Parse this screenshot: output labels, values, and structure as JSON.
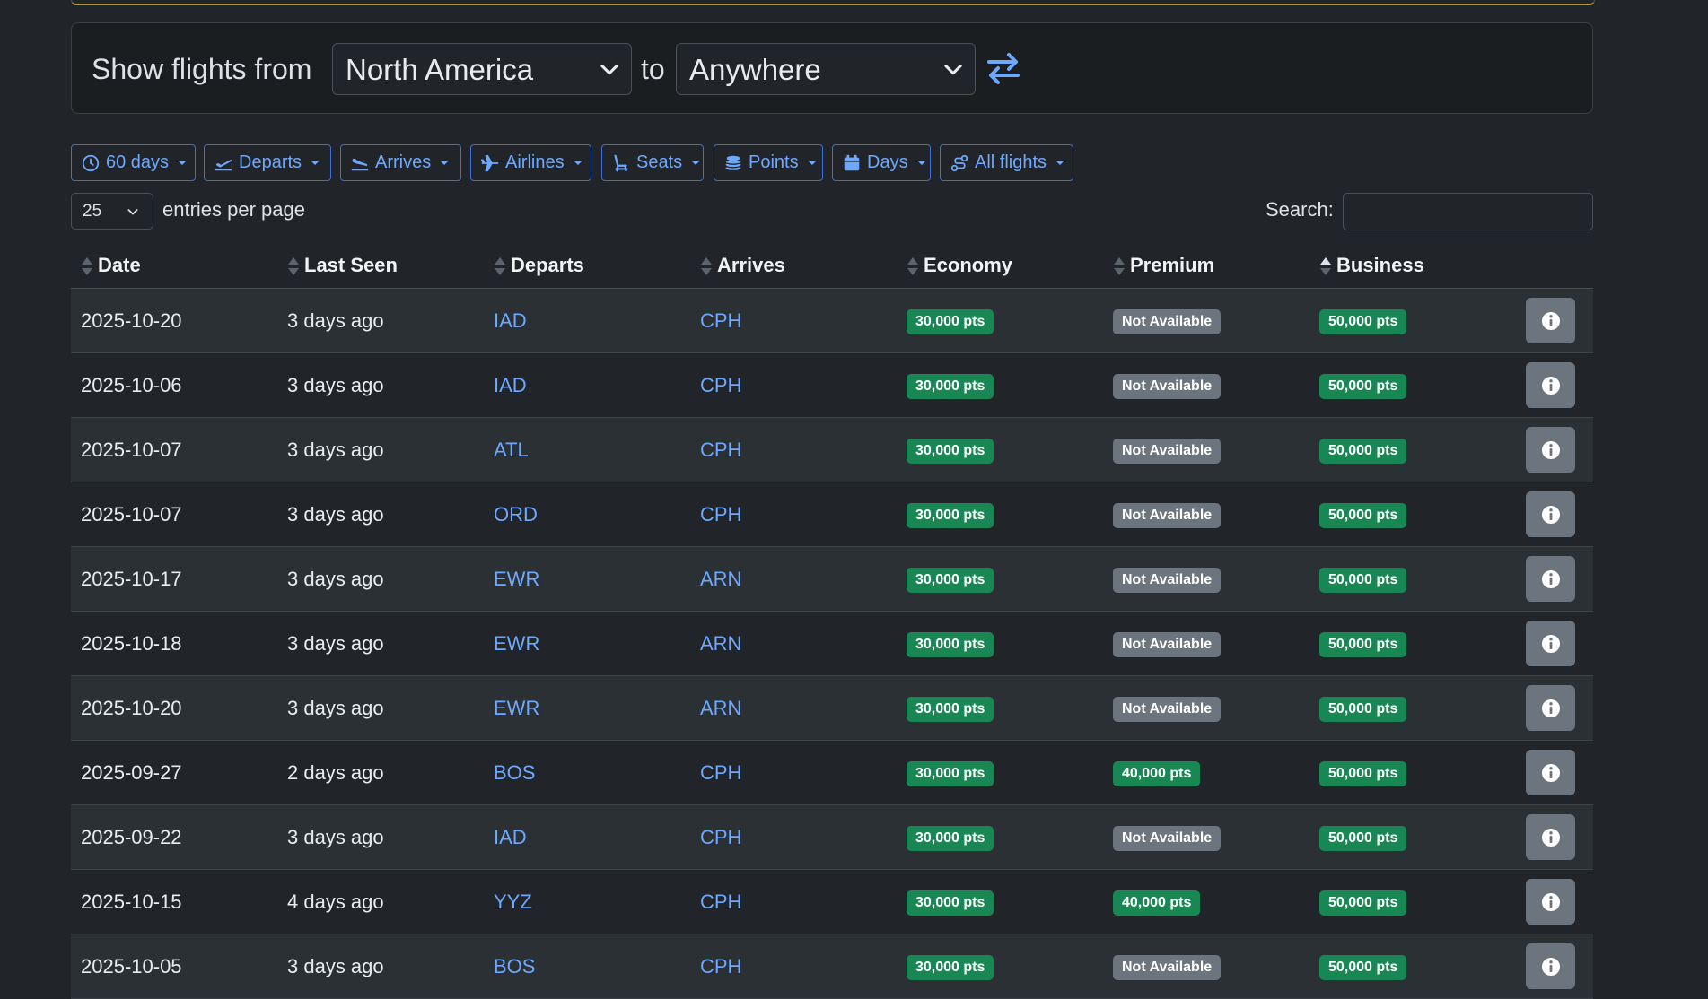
{
  "route": {
    "from_label": "Show flights from",
    "from_value": "North America",
    "to_label": "to",
    "to_value": "Anywhere"
  },
  "filters": [
    {
      "label": "60 days",
      "icon": "clock-icon"
    },
    {
      "label": "Departs",
      "icon": "plane-departure-icon"
    },
    {
      "label": "Arrives",
      "icon": "plane-arrival-icon"
    },
    {
      "label": "Airlines",
      "icon": "plane-icon"
    },
    {
      "label": "Seats",
      "icon": "seat-icon"
    },
    {
      "label": "Points",
      "icon": "coins-icon"
    },
    {
      "label": "Days",
      "icon": "calendar-icon"
    },
    {
      "label": "All flights",
      "icon": "route-icon"
    }
  ],
  "table_controls": {
    "page_length": "25",
    "page_length_label": "entries per page",
    "search_label": "Search:",
    "search_value": ""
  },
  "columns": [
    "Date",
    "Last Seen",
    "Departs",
    "Arrives",
    "Economy",
    "Premium",
    "Business"
  ],
  "sorted_column": "Business",
  "rows": [
    {
      "date": "2025-10-20",
      "last_seen": "3 days ago",
      "departs": "IAD",
      "arrives": "CPH",
      "economy": "30,000 pts",
      "premium": "Not Available",
      "business": "50,000 pts"
    },
    {
      "date": "2025-10-06",
      "last_seen": "3 days ago",
      "departs": "IAD",
      "arrives": "CPH",
      "economy": "30,000 pts",
      "premium": "Not Available",
      "business": "50,000 pts"
    },
    {
      "date": "2025-10-07",
      "last_seen": "3 days ago",
      "departs": "ATL",
      "arrives": "CPH",
      "economy": "30,000 pts",
      "premium": "Not Available",
      "business": "50,000 pts"
    },
    {
      "date": "2025-10-07",
      "last_seen": "3 days ago",
      "departs": "ORD",
      "arrives": "CPH",
      "economy": "30,000 pts",
      "premium": "Not Available",
      "business": "50,000 pts"
    },
    {
      "date": "2025-10-17",
      "last_seen": "3 days ago",
      "departs": "EWR",
      "arrives": "ARN",
      "economy": "30,000 pts",
      "premium": "Not Available",
      "business": "50,000 pts"
    },
    {
      "date": "2025-10-18",
      "last_seen": "3 days ago",
      "departs": "EWR",
      "arrives": "ARN",
      "economy": "30,000 pts",
      "premium": "Not Available",
      "business": "50,000 pts"
    },
    {
      "date": "2025-10-20",
      "last_seen": "3 days ago",
      "departs": "EWR",
      "arrives": "ARN",
      "economy": "30,000 pts",
      "premium": "Not Available",
      "business": "50,000 pts"
    },
    {
      "date": "2025-09-27",
      "last_seen": "2 days ago",
      "departs": "BOS",
      "arrives": "CPH",
      "economy": "30,000 pts",
      "premium": "40,000 pts",
      "business": "50,000 pts"
    },
    {
      "date": "2025-09-22",
      "last_seen": "3 days ago",
      "departs": "IAD",
      "arrives": "CPH",
      "economy": "30,000 pts",
      "premium": "Not Available",
      "business": "50,000 pts"
    },
    {
      "date": "2025-10-15",
      "last_seen": "4 days ago",
      "departs": "YYZ",
      "arrives": "CPH",
      "economy": "30,000 pts",
      "premium": "40,000 pts",
      "business": "50,000 pts"
    },
    {
      "date": "2025-10-05",
      "last_seen": "3 days ago",
      "departs": "BOS",
      "arrives": "CPH",
      "economy": "30,000 pts",
      "premium": "Not Available",
      "business": "50,000 pts"
    }
  ],
  "colors": {
    "available": "#198754",
    "unavailable": "#6c757d",
    "link": "#6ea8fe",
    "background": "#212529"
  }
}
